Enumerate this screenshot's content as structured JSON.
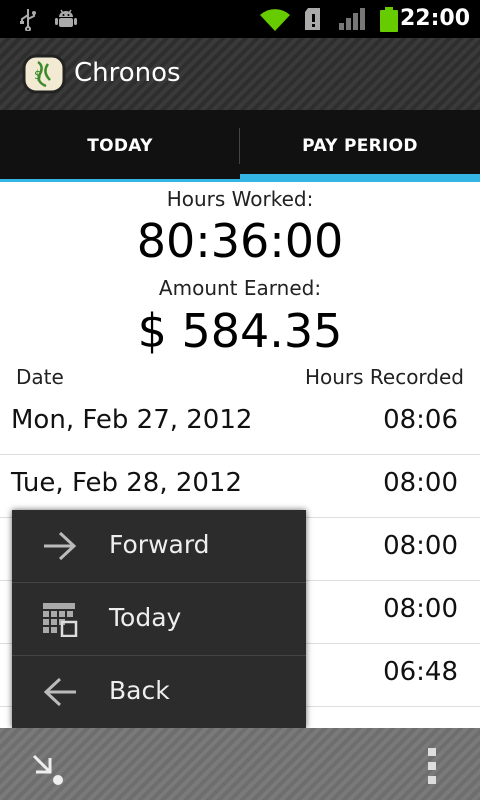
{
  "status_bar": {
    "time": "22:00",
    "icons": [
      "usb-icon",
      "android-debug-icon",
      "wifi-icon",
      "sd-card-icon",
      "signal-icon",
      "battery-icon"
    ]
  },
  "app": {
    "title": "Chronos"
  },
  "tabs": [
    {
      "label": "TODAY"
    },
    {
      "label": "PAY PERIOD",
      "selected": true
    }
  ],
  "summary": {
    "hours_label": "Hours Worked:",
    "hours_value": "80:36:00",
    "amount_label": "Amount Earned:",
    "amount_value": "$ 584.35"
  },
  "table": {
    "headers": {
      "date": "Date",
      "hours": "Hours Recorded"
    },
    "rows": [
      {
        "date": "Mon, Feb 27, 2012",
        "hours": "08:06"
      },
      {
        "date": "Tue, Feb 28, 2012",
        "hours": "08:00"
      },
      {
        "date": "",
        "hours": "08:00"
      },
      {
        "date": "",
        "hours": "08:00"
      },
      {
        "date": "",
        "hours": "06:48"
      }
    ]
  },
  "menu": {
    "items": [
      {
        "label": "Forward",
        "icon": "arrow-right-icon"
      },
      {
        "label": "Today",
        "icon": "calendar-icon"
      },
      {
        "label": "Back",
        "icon": "arrow-left-icon"
      }
    ]
  },
  "bottom_bar": {
    "left_icon": "sleep-icon",
    "right_icon": "overflow-menu-icon"
  },
  "colors": {
    "accent": "#33b5e5",
    "popup_bg": "#2c2c2c"
  }
}
